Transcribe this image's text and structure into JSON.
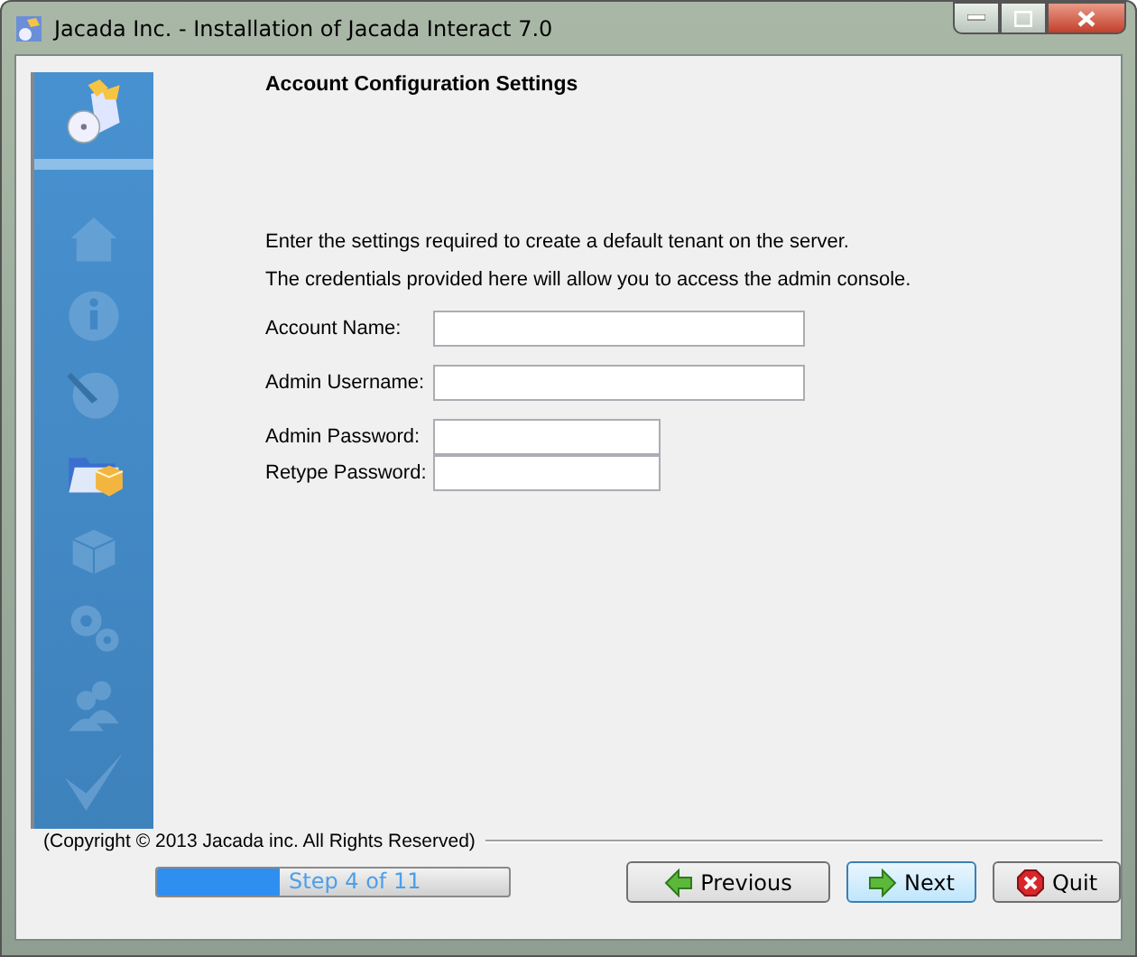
{
  "window": {
    "title": "Jacada Inc. - Installation of Jacada Interact 7.0"
  },
  "steps": [
    {
      "kind": "home",
      "active": false
    },
    {
      "kind": "info",
      "active": false
    },
    {
      "kind": "globe",
      "active": false
    },
    {
      "kind": "folder",
      "active": true
    },
    {
      "kind": "box",
      "active": false
    },
    {
      "kind": "gears",
      "active": false
    },
    {
      "kind": "users",
      "active": false
    },
    {
      "kind": "check",
      "active": false
    }
  ],
  "heading": "Account Configuration Settings",
  "intro": [
    "Enter the settings required to create a default tenant on the server.",
    "The credentials provided here will allow you to access the admin console."
  ],
  "fields": [
    {
      "label": "Account Name:",
      "kind": "wide"
    },
    {
      "label": "Admin Username:",
      "kind": "wide"
    },
    {
      "label": "Admin Password:",
      "kind": "narrow"
    },
    {
      "label": "Retype Password:",
      "kind": "narrow"
    }
  ],
  "copyright": "(Copyright © 2013 Jacada inc. All Rights Reserved)",
  "progress": {
    "level": 0.35,
    "text": "Step 4 of 11"
  },
  "buttons": [
    {
      "label": "Previous",
      "kind": "previous"
    },
    {
      "label": "Next",
      "kind": "next",
      "selected": true
    },
    {
      "label": "Quit",
      "kind": "quit",
      "selected": false
    }
  ]
}
